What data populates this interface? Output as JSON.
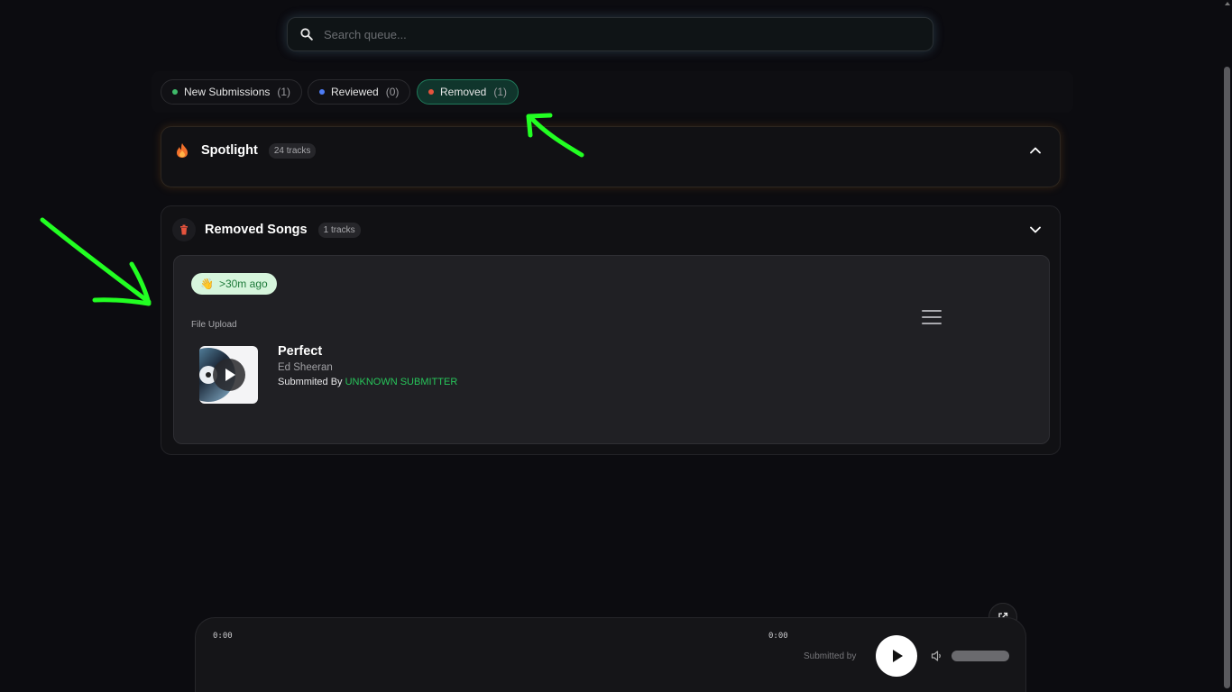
{
  "search": {
    "placeholder": "Search queue..."
  },
  "tabs": [
    {
      "label": "New Submissions",
      "count": "(1)",
      "dot_color": "#3fba6a"
    },
    {
      "label": "Reviewed",
      "count": "(0)",
      "dot_color": "#4d7cf5"
    },
    {
      "label": "Removed",
      "count": "(1)",
      "dot_color": "#e5533d",
      "active": true
    }
  ],
  "spotlight": {
    "title": "Spotlight",
    "count": "24 tracks",
    "icon": "fire-icon",
    "expanded": true
  },
  "removed": {
    "title": "Removed Songs",
    "count": "1 tracks",
    "icon": "trash-icon",
    "card": {
      "time_badge": ">30m ago",
      "source": "File Upload",
      "title": "Perfect",
      "artist": "Ed Sheeran",
      "submitted_by_label": "Submmited By",
      "submitter": "UNKNOWN SUBMITTER"
    }
  },
  "player": {
    "current_time": "0:00",
    "duration": "0:00",
    "submitted_by_label": "Submitted by"
  },
  "colors": {
    "accent_green": "#27c45a",
    "annotation": "#22ff22"
  }
}
